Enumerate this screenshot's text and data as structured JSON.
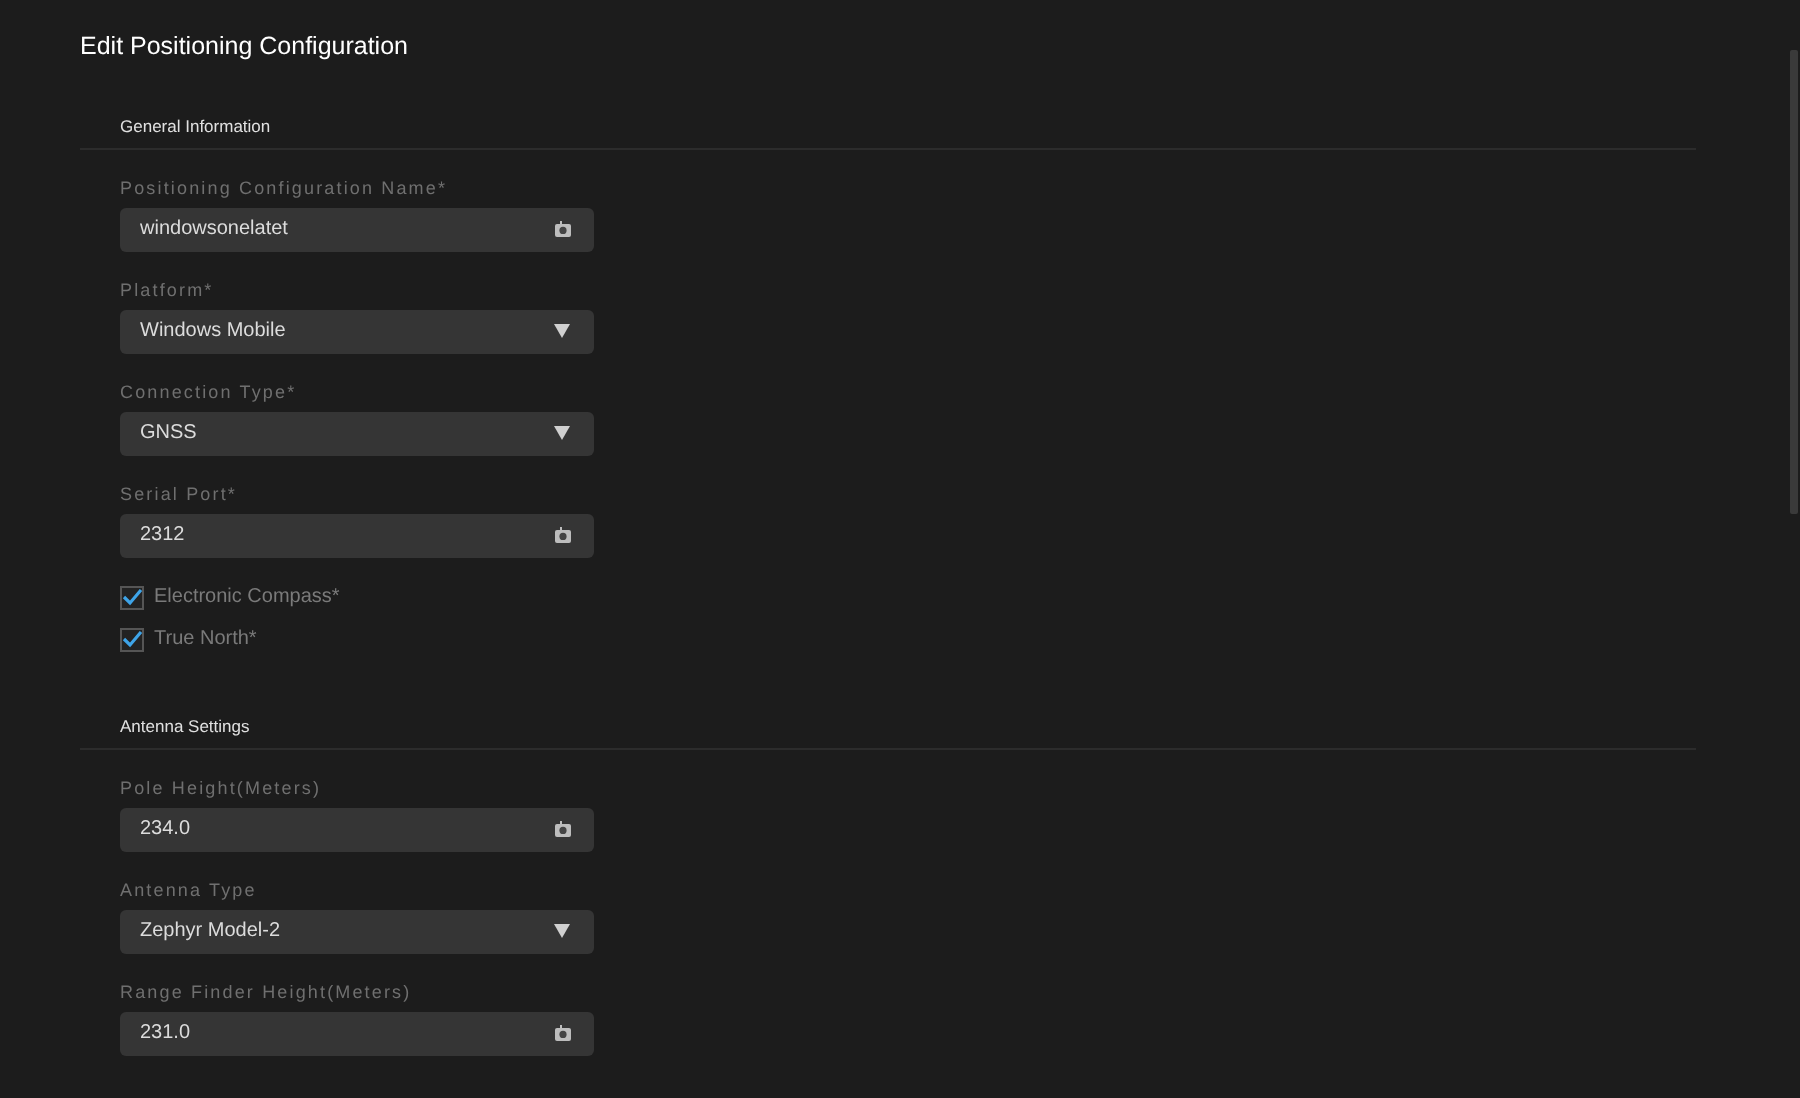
{
  "title": "Edit Positioning Configuration",
  "sections": [
    {
      "heading": "General Information",
      "items": [
        {
          "kind": "text",
          "label": "Positioning Configuration Name*",
          "value": "windowsonelatet"
        },
        {
          "kind": "select",
          "label": "Platform*",
          "value": "Windows Mobile"
        },
        {
          "kind": "select",
          "label": "Connection Type*",
          "value": "GNSS"
        },
        {
          "kind": "text",
          "label": "Serial Port*",
          "value": "2312"
        },
        {
          "kind": "checkbox",
          "label": "Electronic Compass*",
          "checked": true
        },
        {
          "kind": "checkbox",
          "label": "True North*",
          "checked": true
        }
      ]
    },
    {
      "heading": "Antenna Settings",
      "items": [
        {
          "kind": "text",
          "label": "Pole Height(Meters)",
          "value": "234.0"
        },
        {
          "kind": "select",
          "label": "Antenna Type",
          "value": "Zephyr Model-2"
        },
        {
          "kind": "text",
          "label": "Range Finder Height(Meters)",
          "value": "231.0"
        }
      ]
    }
  ]
}
